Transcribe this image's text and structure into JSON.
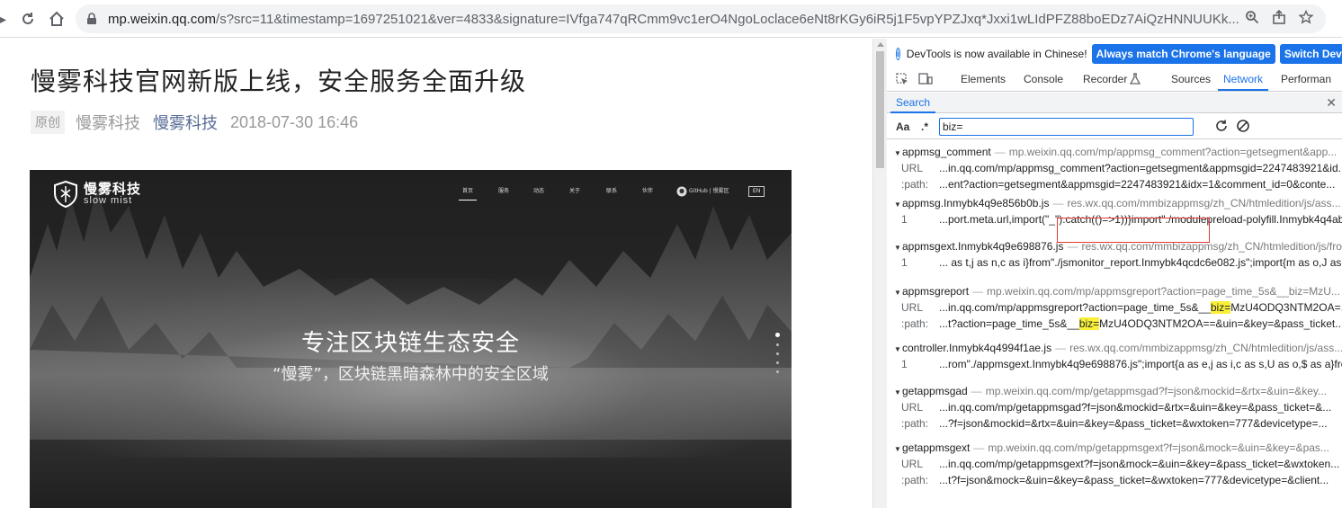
{
  "browser": {
    "url_host": "mp.weixin.qq.com",
    "url_rest": "/s?src=11&timestamp=1697251021&ver=4833&signature=IVfga747qRCmm9vc1erO4NgoLoclace6eNt8rKGy6iR5j1F5vpYPZJxq*Jxxi1wLIdPFZ88boEDz7AiQzHNNUUKk..."
  },
  "article": {
    "title": "慢雾科技官网新版上线，安全服务全面升级",
    "original_badge": "原创",
    "author": "慢雾科技",
    "account": "慢雾科技",
    "date": "2018-07-30 16:46",
    "banner": {
      "logo_cn": "慢雾科技",
      "logo_en": "slow mist",
      "nav": [
        "首页",
        "服务",
        "动态",
        "关于",
        "联系",
        "伙伴",
        "GitHub | 慢雾区"
      ],
      "lang": "EN",
      "headline": "专注区块链生态安全",
      "subheadline": "“慢雾”，区块链黑暗森林中的安全区域"
    }
  },
  "devtools": {
    "info_text": "DevTools is now available in Chinese!",
    "btn_match": "Always match Chrome's language",
    "btn_switch": "Switch DevTo",
    "tabs": [
      "Elements",
      "Console",
      "Recorder",
      "Sources",
      "Network",
      "Performan"
    ],
    "active_tab": "Network",
    "search_tab": "Search",
    "opt_case": "Aa",
    "opt_regex": ".*",
    "search_value": "biz=",
    "colors": {
      "accent": "#1a73e8",
      "highlight": "#f9f03a",
      "annotation": "#e53935"
    },
    "results": [
      {
        "file": "appmsg_comment",
        "loc": "mp.weixin.qq.com/mp/appmsg_comment?action=getsegment&app...",
        "lines": [
          {
            "num": "URL",
            "text": "...in.qq.com/mp/appmsg_comment?action=getsegment&appmsgid=2247483921&id..."
          },
          {
            "num": ":path:",
            "text": "...ent?action=getsegment&appmsgid=2247483921&idx=1&comment_id=0&conte..."
          }
        ]
      },
      {
        "file": "appmsg.Inmybk4q9e856b0b.js",
        "loc": "res.wx.qq.com/mmbizappmsg/zh_CN/htmledition/js/ass...",
        "lines": [
          {
            "num": "1",
            "text": "...port.meta.url,import(\"_\").catch(()=>1))}import\"./modulepreload-polyfill.Inmybk4q4ab..."
          }
        ]
      },
      {
        "file": "appmsgext.Inmybk4q9e698876.js",
        "loc": "res.wx.qq.com/mmbizappmsg/zh_CN/htmledition/js/fro...",
        "lines": [
          {
            "num": "1",
            "text": "... as t,j as n,c as i}from\"./jsmonitor_report.Inmybk4qcdc6e082.js\";import{m as o,J as r}fro..."
          }
        ]
      },
      {
        "file": "appmsgreport",
        "loc": "mp.weixin.qq.com/mp/appmsgreport?action=page_time_5s&__biz=MzU...",
        "lines": [
          {
            "num": "URL",
            "pre": "...in.qq.com/mp/appmsgreport?action=page_time_5s&__",
            "hl": "biz=",
            "post": "MzU4ODQ3NTM2OA=..."
          },
          {
            "num": ":path:",
            "pre": "...t?action=page_time_5s&__",
            "hl": "biz=",
            "post": "MzU4ODQ3NTM2OA==&uin=&key=&pass_ticket..."
          }
        ]
      },
      {
        "file": "controller.Inmybk4q4994f1ae.js",
        "loc": "res.wx.qq.com/mmbizappmsg/zh_CN/htmledition/js/ass...",
        "lines": [
          {
            "num": "1",
            "text": "...rom\"./appmsgext.Inmybk4q9e698876.js\";import{a as e,j as i,c as s,U as o,$ as a}from\"./j..."
          }
        ]
      },
      {
        "file": "getappmsgad",
        "loc": "mp.weixin.qq.com/mp/getappmsgad?f=json&mockid=&rtx=&uin=&key...",
        "lines": [
          {
            "num": "URL",
            "text": "...in.qq.com/mp/getappmsgad?f=json&mockid=&rtx=&uin=&key=&pass_ticket=&..."
          },
          {
            "num": ":path:",
            "text": "...?f=json&mockid=&rtx=&uin=&key=&pass_ticket=&wxtoken=777&devicetype=..."
          }
        ]
      },
      {
        "file": "getappmsgext",
        "loc": "mp.weixin.qq.com/mp/getappmsgext?f=json&mock=&uin=&key=&pas...",
        "lines": [
          {
            "num": "URL",
            "text": "...in.qq.com/mp/getappmsgext?f=json&mock=&uin=&key=&pass_ticket=&wxtoken..."
          },
          {
            "num": ":path:",
            "text": "...t?f=json&mock=&uin=&key=&pass_ticket=&wxtoken=777&devicetype=&client..."
          }
        ]
      }
    ]
  }
}
